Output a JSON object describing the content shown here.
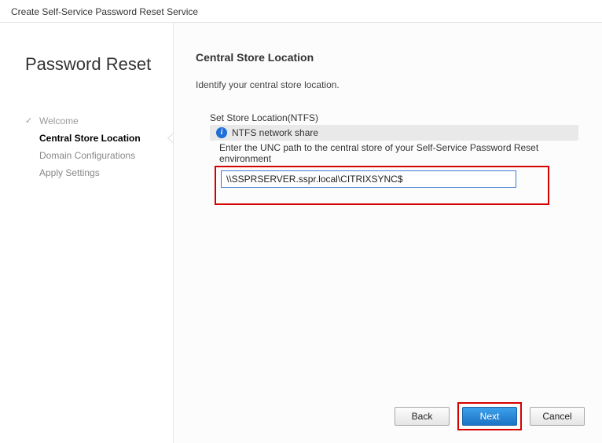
{
  "window": {
    "title": "Create Self-Service Password Reset Service"
  },
  "sidebar": {
    "heading": "Password Reset",
    "steps": [
      {
        "label": "Welcome",
        "state": "completed"
      },
      {
        "label": "Central Store Location",
        "state": "active"
      },
      {
        "label": "Domain Configurations",
        "state": "pending"
      },
      {
        "label": "Apply Settings",
        "state": "pending"
      }
    ]
  },
  "main": {
    "heading": "Central Store Location",
    "subtitle": "Identify your central store location.",
    "section_label": "Set Store Location(NTFS)",
    "info_text": "NTFS network share",
    "instruction": "Enter the UNC path to the central store of your Self-Service Password Reset environment",
    "unc_value": "\\\\SSPRSERVER.sspr.local\\CITRIXSYNC$"
  },
  "footer": {
    "back": "Back",
    "next": "Next",
    "cancel": "Cancel"
  }
}
